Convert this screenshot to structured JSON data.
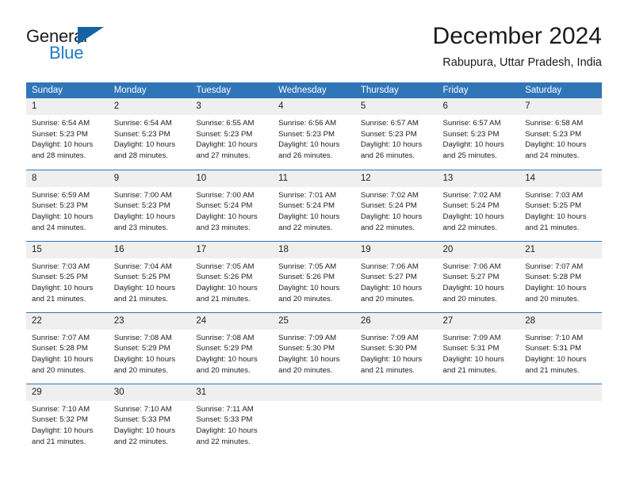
{
  "brand": {
    "name_top": "General",
    "name_bottom": "Blue",
    "triangle_color": "#1464a5",
    "bottom_color": "#1f7bc1"
  },
  "header": {
    "title": "December 2024",
    "subtitle": "Rabupura, Uttar Pradesh, India"
  },
  "theme": {
    "header_bg": "#3075b8",
    "daynum_bg": "#efefef",
    "text": "#222222"
  },
  "weekdays": [
    "Sunday",
    "Monday",
    "Tuesday",
    "Wednesday",
    "Thursday",
    "Friday",
    "Saturday"
  ],
  "labels": {
    "sunrise_prefix": "Sunrise:",
    "sunset_prefix": "Sunset:",
    "daylight_prefix": "Daylight:"
  },
  "weeks": [
    [
      {
        "day": "1",
        "sunrise": "Sunrise: 6:54 AM",
        "sunset": "Sunset: 5:23 PM",
        "daylight1": "Daylight: 10 hours",
        "daylight2": "and 28 minutes."
      },
      {
        "day": "2",
        "sunrise": "Sunrise: 6:54 AM",
        "sunset": "Sunset: 5:23 PM",
        "daylight1": "Daylight: 10 hours",
        "daylight2": "and 28 minutes."
      },
      {
        "day": "3",
        "sunrise": "Sunrise: 6:55 AM",
        "sunset": "Sunset: 5:23 PM",
        "daylight1": "Daylight: 10 hours",
        "daylight2": "and 27 minutes."
      },
      {
        "day": "4",
        "sunrise": "Sunrise: 6:56 AM",
        "sunset": "Sunset: 5:23 PM",
        "daylight1": "Daylight: 10 hours",
        "daylight2": "and 26 minutes."
      },
      {
        "day": "5",
        "sunrise": "Sunrise: 6:57 AM",
        "sunset": "Sunset: 5:23 PM",
        "daylight1": "Daylight: 10 hours",
        "daylight2": "and 26 minutes."
      },
      {
        "day": "6",
        "sunrise": "Sunrise: 6:57 AM",
        "sunset": "Sunset: 5:23 PM",
        "daylight1": "Daylight: 10 hours",
        "daylight2": "and 25 minutes."
      },
      {
        "day": "7",
        "sunrise": "Sunrise: 6:58 AM",
        "sunset": "Sunset: 5:23 PM",
        "daylight1": "Daylight: 10 hours",
        "daylight2": "and 24 minutes."
      }
    ],
    [
      {
        "day": "8",
        "sunrise": "Sunrise: 6:59 AM",
        "sunset": "Sunset: 5:23 PM",
        "daylight1": "Daylight: 10 hours",
        "daylight2": "and 24 minutes."
      },
      {
        "day": "9",
        "sunrise": "Sunrise: 7:00 AM",
        "sunset": "Sunset: 5:23 PM",
        "daylight1": "Daylight: 10 hours",
        "daylight2": "and 23 minutes."
      },
      {
        "day": "10",
        "sunrise": "Sunrise: 7:00 AM",
        "sunset": "Sunset: 5:24 PM",
        "daylight1": "Daylight: 10 hours",
        "daylight2": "and 23 minutes."
      },
      {
        "day": "11",
        "sunrise": "Sunrise: 7:01 AM",
        "sunset": "Sunset: 5:24 PM",
        "daylight1": "Daylight: 10 hours",
        "daylight2": "and 22 minutes."
      },
      {
        "day": "12",
        "sunrise": "Sunrise: 7:02 AM",
        "sunset": "Sunset: 5:24 PM",
        "daylight1": "Daylight: 10 hours",
        "daylight2": "and 22 minutes."
      },
      {
        "day": "13",
        "sunrise": "Sunrise: 7:02 AM",
        "sunset": "Sunset: 5:24 PM",
        "daylight1": "Daylight: 10 hours",
        "daylight2": "and 22 minutes."
      },
      {
        "day": "14",
        "sunrise": "Sunrise: 7:03 AM",
        "sunset": "Sunset: 5:25 PM",
        "daylight1": "Daylight: 10 hours",
        "daylight2": "and 21 minutes."
      }
    ],
    [
      {
        "day": "15",
        "sunrise": "Sunrise: 7:03 AM",
        "sunset": "Sunset: 5:25 PM",
        "daylight1": "Daylight: 10 hours",
        "daylight2": "and 21 minutes."
      },
      {
        "day": "16",
        "sunrise": "Sunrise: 7:04 AM",
        "sunset": "Sunset: 5:25 PM",
        "daylight1": "Daylight: 10 hours",
        "daylight2": "and 21 minutes."
      },
      {
        "day": "17",
        "sunrise": "Sunrise: 7:05 AM",
        "sunset": "Sunset: 5:26 PM",
        "daylight1": "Daylight: 10 hours",
        "daylight2": "and 21 minutes."
      },
      {
        "day": "18",
        "sunrise": "Sunrise: 7:05 AM",
        "sunset": "Sunset: 5:26 PM",
        "daylight1": "Daylight: 10 hours",
        "daylight2": "and 20 minutes."
      },
      {
        "day": "19",
        "sunrise": "Sunrise: 7:06 AM",
        "sunset": "Sunset: 5:27 PM",
        "daylight1": "Daylight: 10 hours",
        "daylight2": "and 20 minutes."
      },
      {
        "day": "20",
        "sunrise": "Sunrise: 7:06 AM",
        "sunset": "Sunset: 5:27 PM",
        "daylight1": "Daylight: 10 hours",
        "daylight2": "and 20 minutes."
      },
      {
        "day": "21",
        "sunrise": "Sunrise: 7:07 AM",
        "sunset": "Sunset: 5:28 PM",
        "daylight1": "Daylight: 10 hours",
        "daylight2": "and 20 minutes."
      }
    ],
    [
      {
        "day": "22",
        "sunrise": "Sunrise: 7:07 AM",
        "sunset": "Sunset: 5:28 PM",
        "daylight1": "Daylight: 10 hours",
        "daylight2": "and 20 minutes."
      },
      {
        "day": "23",
        "sunrise": "Sunrise: 7:08 AM",
        "sunset": "Sunset: 5:29 PM",
        "daylight1": "Daylight: 10 hours",
        "daylight2": "and 20 minutes."
      },
      {
        "day": "24",
        "sunrise": "Sunrise: 7:08 AM",
        "sunset": "Sunset: 5:29 PM",
        "daylight1": "Daylight: 10 hours",
        "daylight2": "and 20 minutes."
      },
      {
        "day": "25",
        "sunrise": "Sunrise: 7:09 AM",
        "sunset": "Sunset: 5:30 PM",
        "daylight1": "Daylight: 10 hours",
        "daylight2": "and 20 minutes."
      },
      {
        "day": "26",
        "sunrise": "Sunrise: 7:09 AM",
        "sunset": "Sunset: 5:30 PM",
        "daylight1": "Daylight: 10 hours",
        "daylight2": "and 21 minutes."
      },
      {
        "day": "27",
        "sunrise": "Sunrise: 7:09 AM",
        "sunset": "Sunset: 5:31 PM",
        "daylight1": "Daylight: 10 hours",
        "daylight2": "and 21 minutes."
      },
      {
        "day": "28",
        "sunrise": "Sunrise: 7:10 AM",
        "sunset": "Sunset: 5:31 PM",
        "daylight1": "Daylight: 10 hours",
        "daylight2": "and 21 minutes."
      }
    ],
    [
      {
        "day": "29",
        "sunrise": "Sunrise: 7:10 AM",
        "sunset": "Sunset: 5:32 PM",
        "daylight1": "Daylight: 10 hours",
        "daylight2": "and 21 minutes."
      },
      {
        "day": "30",
        "sunrise": "Sunrise: 7:10 AM",
        "sunset": "Sunset: 5:33 PM",
        "daylight1": "Daylight: 10 hours",
        "daylight2": "and 22 minutes."
      },
      {
        "day": "31",
        "sunrise": "Sunrise: 7:11 AM",
        "sunset": "Sunset: 5:33 PM",
        "daylight1": "Daylight: 10 hours",
        "daylight2": "and 22 minutes."
      },
      {
        "day": "",
        "sunrise": "",
        "sunset": "",
        "daylight1": "",
        "daylight2": ""
      },
      {
        "day": "",
        "sunrise": "",
        "sunset": "",
        "daylight1": "",
        "daylight2": ""
      },
      {
        "day": "",
        "sunrise": "",
        "sunset": "",
        "daylight1": "",
        "daylight2": ""
      },
      {
        "day": "",
        "sunrise": "",
        "sunset": "",
        "daylight1": "",
        "daylight2": ""
      }
    ]
  ]
}
